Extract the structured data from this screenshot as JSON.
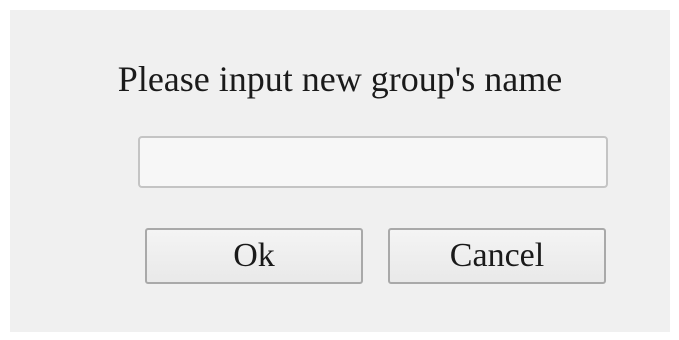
{
  "dialog": {
    "prompt": "Please input new group's name",
    "name_input": {
      "value": "",
      "placeholder": ""
    },
    "ok_label": "Ok",
    "cancel_label": "Cancel"
  }
}
